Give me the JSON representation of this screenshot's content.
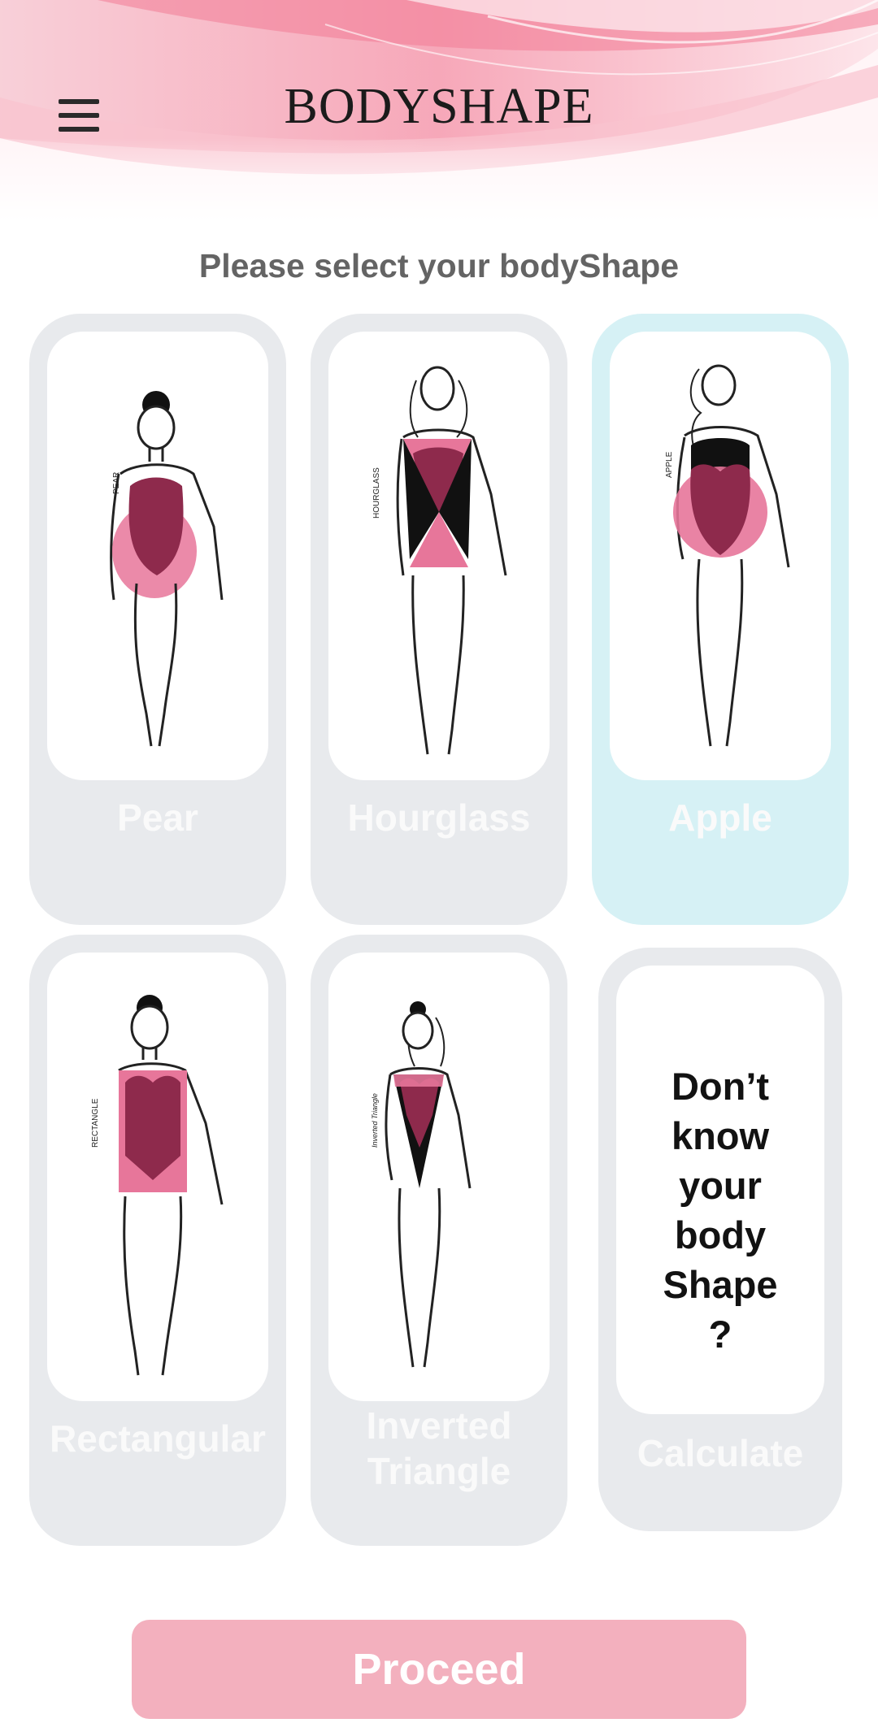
{
  "header": {
    "brand": "BODYSHAPE",
    "menu_icon": "hamburger-menu-icon"
  },
  "prompt": "Please select your bodyShape",
  "shapes": [
    {
      "label_line1": "Pear",
      "label_line2": "",
      "side_label": "PEAR",
      "selected": false
    },
    {
      "label_line1": "Hourglass",
      "label_line2": "",
      "side_label": "HOURGLASS",
      "selected": false
    },
    {
      "label_line1": "Apple",
      "label_line2": "",
      "side_label": "APPLE",
      "selected": true
    },
    {
      "label_line1": "Rectangular",
      "label_line2": "",
      "side_label": "RECTANGLE",
      "selected": false
    },
    {
      "label_line1": "Inverted",
      "label_line2": "Triangle",
      "side_label": "Inverted Triangle",
      "selected": false
    }
  ],
  "unknown_card": {
    "lines": [
      "Don’t",
      "know",
      "your",
      "body",
      "Shape",
      "?"
    ],
    "label": "Calculate"
  },
  "proceed_label": "Proceed",
  "colors": {
    "accent": "#f3b0be",
    "card_bg": "#e8eaed",
    "selected_bg": "#d6f1f5",
    "shape_dark": "#8e2a4c",
    "shape_light": "#e7769a"
  }
}
